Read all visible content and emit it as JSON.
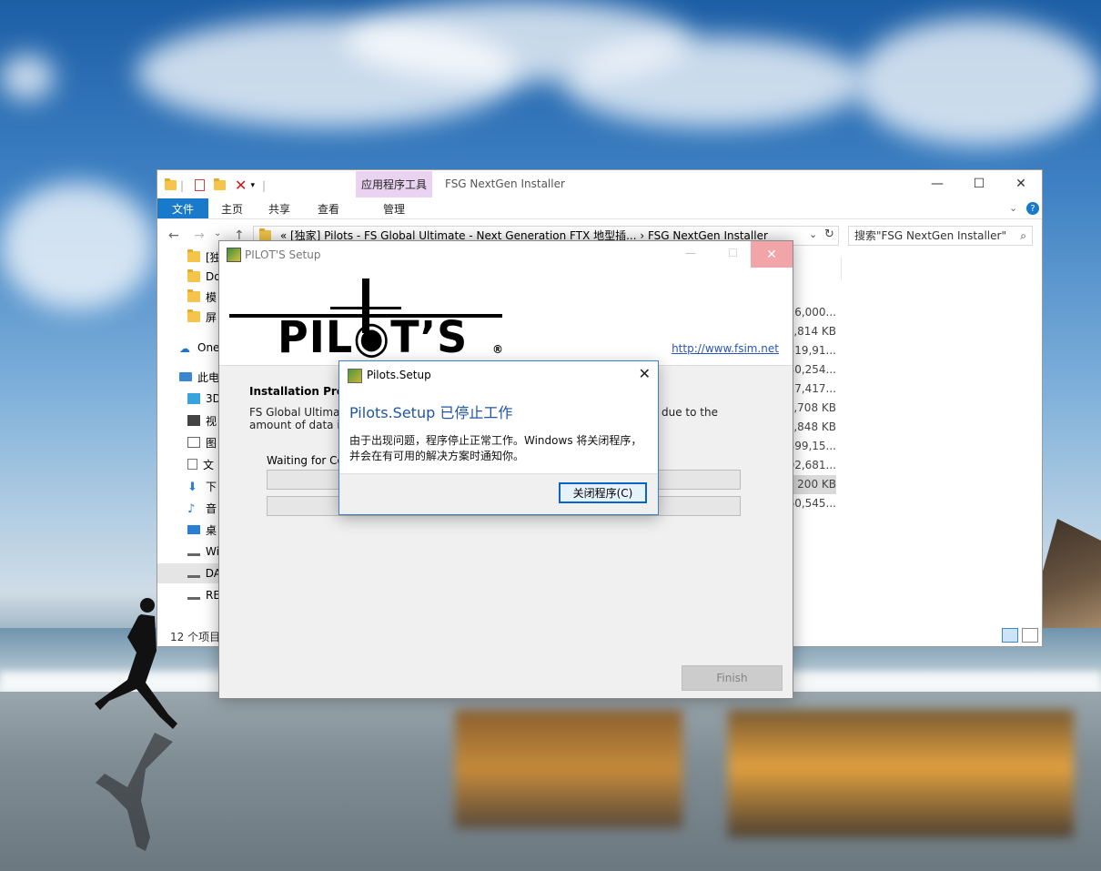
{
  "explorer": {
    "title": "FSG NextGen Installer",
    "context_tab_header": "应用程序工具",
    "ribbon_tabs": [
      {
        "label": "文件"
      },
      {
        "label": "主页"
      },
      {
        "label": "共享"
      },
      {
        "label": "查看"
      },
      {
        "label": "管理"
      }
    ],
    "address": "«  [独家] Pilots - FS Global Ultimate - Next Generation FTX  地型插...  ›  FSG NextGen Installer",
    "search_placeholder": "搜索\"FSG NextGen Installer\"",
    "nav_items": [
      {
        "label": "[独"
      },
      {
        "label": "Do"
      },
      {
        "label": "模"
      },
      {
        "label": "屏"
      },
      {
        "label": "One"
      },
      {
        "label": "此电"
      },
      {
        "label": "3D"
      },
      {
        "label": "视"
      },
      {
        "label": "图"
      },
      {
        "label": "文"
      },
      {
        "label": "下"
      },
      {
        "label": "音"
      },
      {
        "label": "桌"
      },
      {
        "label": "Wi"
      },
      {
        "label": "DA"
      },
      {
        "label": "RE"
      }
    ],
    "sizes": [
      "16,000...",
      ",814 KB",
      "519,91...",
      "30,254...",
      "27,417...",
      ",708 KB",
      ",848 KB",
      "399,15...",
      "02,681...",
      "200 KB",
      "60,545..."
    ],
    "status": "12 个项目"
  },
  "setup": {
    "title": "PILOT'S Setup",
    "logo_text": "PIL◉T’S",
    "logo_reg": "®",
    "link": "http://www.fsim.net",
    "heading": "Installation Prog",
    "desc": "FS Global Ultimate",
    "desc_line2": "amount of data in",
    "desc_right": "due to the",
    "waiting": "Waiting for Co",
    "finish": "Finish"
  },
  "error_dialog": {
    "title": "Pilots.Setup",
    "main": "Pilots.Setup 已停止工作",
    "message": "由于出现问题，程序停止正常工作。Windows 将关闭程序，并会在有可用的解决方案时通知你。",
    "button": "关闭程序(C)"
  },
  "colors": {
    "accent": "#1979ca",
    "error_heading": "#1e55a8",
    "link": "#2a55b8",
    "close_hover": "#f1a5a8"
  }
}
